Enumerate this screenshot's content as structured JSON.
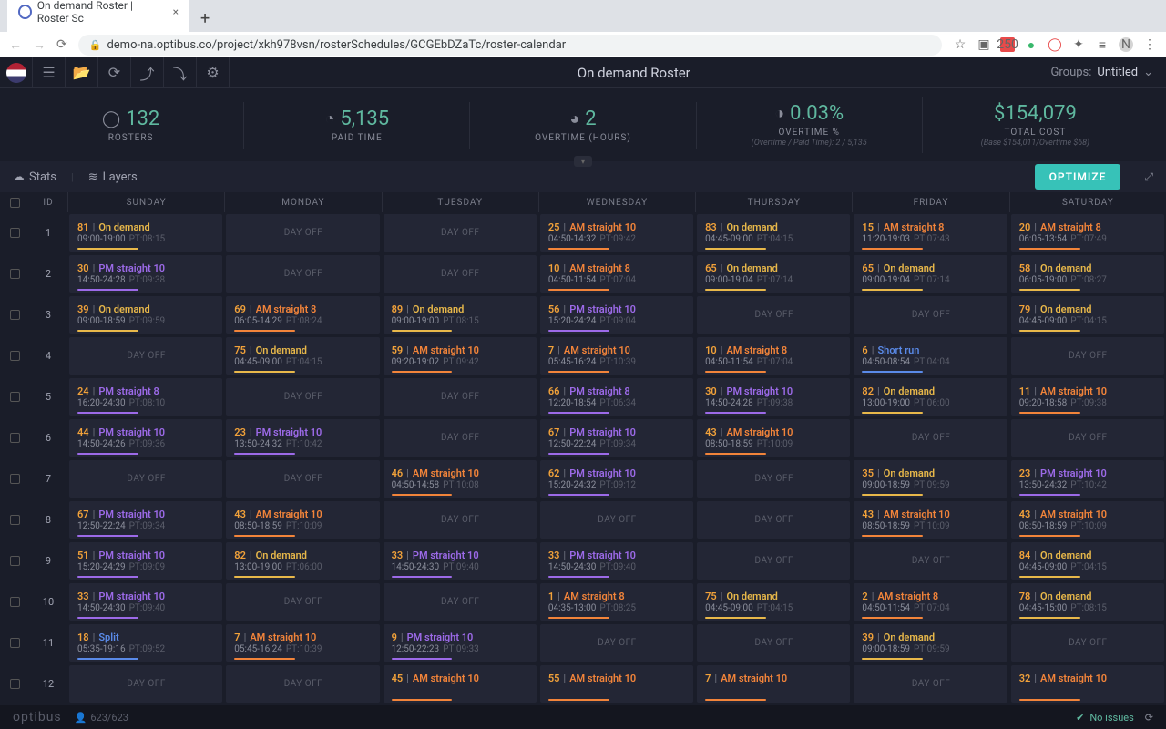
{
  "browser": {
    "tab_title": "On demand Roster | Roster Sc",
    "url": "demo-na.optibus.co/project/xkh978vsn/rosterSchedules/GCGEbDZaTc/roster-calendar",
    "ext_badge": "250",
    "avatar": "N"
  },
  "toolbar": {
    "title": "On demand Roster",
    "groups_label": "Groups:",
    "groups_value": "Untitled"
  },
  "metrics": [
    {
      "value": "132",
      "label": "ROSTERS",
      "sub": ""
    },
    {
      "value": "5,135",
      "label": "PAID TIME",
      "sub": ""
    },
    {
      "value": "2",
      "label": "OVERTIME (HOURS)",
      "sub": ""
    },
    {
      "value": "0.03%",
      "label": "OVERTIME %",
      "sub": "(Overtime / Paid Time): 2 / 5,135"
    },
    {
      "value": "$154,079",
      "label": "TOTAL COST",
      "sub": "(Base $154,011/Overtime $68)"
    }
  ],
  "subbar": {
    "stats": "Stats",
    "layers": "Layers",
    "optimize": "OPTIMIZE"
  },
  "headers": {
    "id": "ID",
    "days": [
      "SUNDAY",
      "MONDAY",
      "TUESDAY",
      "WEDNESDAY",
      "THURSDAY",
      "FRIDAY",
      "SATURDAY"
    ]
  },
  "day_off": "DAY OFF",
  "rows": [
    {
      "id": "1",
      "cells": [
        {
          "t": "on",
          "id": "81",
          "n": "On demand",
          "time": "09:00-19:00",
          "pt": "PT:08:15"
        },
        null,
        null,
        {
          "t": "am",
          "id": "25",
          "n": "AM straight 10",
          "time": "04:50-14:32",
          "pt": "PT:09:42"
        },
        {
          "t": "on",
          "id": "83",
          "n": "On demand",
          "time": "04:45-09:00",
          "pt": "PT:04:15"
        },
        {
          "t": "am",
          "id": "15",
          "n": "AM straight 8",
          "time": "11:20-19:03",
          "pt": "PT:07:43"
        },
        {
          "t": "am",
          "id": "20",
          "n": "AM straight 8",
          "time": "06:05-13:54",
          "pt": "PT:07:49"
        }
      ]
    },
    {
      "id": "2",
      "cells": [
        {
          "t": "pm",
          "id": "30",
          "n": "PM straight 10",
          "time": "14:50-24:28",
          "pt": "PT:09:38"
        },
        null,
        null,
        {
          "t": "am",
          "id": "10",
          "n": "AM straight 8",
          "time": "04:50-11:54",
          "pt": "PT:07:04"
        },
        {
          "t": "on",
          "id": "65",
          "n": "On demand",
          "time": "09:00-19:04",
          "pt": "PT:07:14"
        },
        {
          "t": "on",
          "id": "65",
          "n": "On demand",
          "time": "09:00-19:04",
          "pt": "PT:07:14"
        },
        {
          "t": "on",
          "id": "58",
          "n": "On demand",
          "time": "06:05-19:00",
          "pt": "PT:08:27"
        }
      ]
    },
    {
      "id": "3",
      "cells": [
        {
          "t": "on",
          "id": "39",
          "n": "On demand",
          "time": "09:00-18:59",
          "pt": "PT:09:59"
        },
        {
          "t": "am",
          "id": "69",
          "n": "AM straight 8",
          "time": "06:05-14:29",
          "pt": "PT:08:24"
        },
        {
          "t": "on",
          "id": "89",
          "n": "On demand",
          "time": "09:00-19:00",
          "pt": "PT:08:15"
        },
        {
          "t": "pm",
          "id": "56",
          "n": "PM straight 10",
          "time": "15:20-24:24",
          "pt": "PT:09:04"
        },
        null,
        null,
        {
          "t": "on",
          "id": "79",
          "n": "On demand",
          "time": "04:45-09:00",
          "pt": "PT:04:15"
        }
      ]
    },
    {
      "id": "4",
      "cells": [
        null,
        {
          "t": "on",
          "id": "75",
          "n": "On demand",
          "time": "04:45-09:00",
          "pt": "PT:04:15"
        },
        {
          "t": "am",
          "id": "59",
          "n": "AM straight 10",
          "time": "09:20-19:02",
          "pt": "PT:09:42"
        },
        {
          "t": "am",
          "id": "7",
          "n": "AM straight 10",
          "time": "05:45-16:24",
          "pt": "PT:10:39"
        },
        {
          "t": "am",
          "id": "10",
          "n": "AM straight 8",
          "time": "04:50-11:54",
          "pt": "PT:07:04"
        },
        {
          "t": "sr",
          "id": "6",
          "n": "Short run",
          "time": "04:50-08:54",
          "pt": "PT:04:04"
        },
        null
      ]
    },
    {
      "id": "5",
      "cells": [
        {
          "t": "pm",
          "id": "24",
          "n": "PM straight 8",
          "time": "16:20-24:30",
          "pt": "PT:08:10"
        },
        null,
        null,
        {
          "t": "pm",
          "id": "66",
          "n": "PM straight 8",
          "time": "12:20-18:54",
          "pt": "PT:06:34"
        },
        {
          "t": "pm",
          "id": "30",
          "n": "PM straight 10",
          "time": "14:50-24:28",
          "pt": "PT:09:38"
        },
        {
          "t": "on",
          "id": "82",
          "n": "On demand",
          "time": "13:00-19:00",
          "pt": "PT:06:00"
        },
        {
          "t": "am",
          "id": "11",
          "n": "AM straight 10",
          "time": "09:20-18:58",
          "pt": "PT:09:38"
        }
      ]
    },
    {
      "id": "6",
      "cells": [
        {
          "t": "pm",
          "id": "44",
          "n": "PM straight 10",
          "time": "14:50-24:26",
          "pt": "PT:09:36"
        },
        {
          "t": "pm",
          "id": "23",
          "n": "PM straight 10",
          "time": "13:50-24:32",
          "pt": "PT:10:42"
        },
        null,
        {
          "t": "pm",
          "id": "67",
          "n": "PM straight 10",
          "time": "12:50-22:24",
          "pt": "PT:09:34"
        },
        {
          "t": "am",
          "id": "43",
          "n": "AM straight 10",
          "time": "08:50-18:59",
          "pt": "PT:10:09"
        },
        null,
        null
      ]
    },
    {
      "id": "7",
      "cells": [
        null,
        null,
        {
          "t": "am",
          "id": "46",
          "n": "AM straight 10",
          "time": "04:50-14:58",
          "pt": "PT:10:08"
        },
        {
          "t": "pm",
          "id": "62",
          "n": "PM straight 10",
          "time": "15:20-24:32",
          "pt": "PT:09:12"
        },
        null,
        {
          "t": "on",
          "id": "35",
          "n": "On demand",
          "time": "09:00-18:59",
          "pt": "PT:09:59"
        },
        {
          "t": "pm",
          "id": "23",
          "n": "PM straight 10",
          "time": "13:50-24:32",
          "pt": "PT:10:42"
        }
      ]
    },
    {
      "id": "8",
      "cells": [
        {
          "t": "pm",
          "id": "67",
          "n": "PM straight 10",
          "time": "12:50-22:24",
          "pt": "PT:09:34"
        },
        {
          "t": "am",
          "id": "43",
          "n": "AM straight 10",
          "time": "08:50-18:59",
          "pt": "PT:10:09"
        },
        null,
        null,
        null,
        {
          "t": "am",
          "id": "43",
          "n": "AM straight 10",
          "time": "08:50-18:59",
          "pt": "PT:10:09"
        },
        {
          "t": "am",
          "id": "43",
          "n": "AM straight 10",
          "time": "08:50-18:59",
          "pt": "PT:10:09"
        }
      ]
    },
    {
      "id": "9",
      "cells": [
        {
          "t": "pm",
          "id": "51",
          "n": "PM straight 10",
          "time": "15:20-24:29",
          "pt": "PT:09:09"
        },
        {
          "t": "on",
          "id": "82",
          "n": "On demand",
          "time": "13:00-19:00",
          "pt": "PT:06:00"
        },
        {
          "t": "pm",
          "id": "33",
          "n": "PM straight 10",
          "time": "14:50-24:30",
          "pt": "PT:09:40"
        },
        {
          "t": "pm",
          "id": "33",
          "n": "PM straight 10",
          "time": "14:50-24:30",
          "pt": "PT:09:40"
        },
        null,
        null,
        {
          "t": "on",
          "id": "84",
          "n": "On demand",
          "time": "04:45-09:00",
          "pt": "PT:04:15"
        }
      ]
    },
    {
      "id": "10",
      "cells": [
        {
          "t": "pm",
          "id": "33",
          "n": "PM straight 10",
          "time": "14:50-24:30",
          "pt": "PT:09:40"
        },
        null,
        null,
        {
          "t": "am",
          "id": "1",
          "n": "AM straight 8",
          "time": "04:35-13:00",
          "pt": "PT:08:25"
        },
        {
          "t": "on",
          "id": "75",
          "n": "On demand",
          "time": "04:45-09:00",
          "pt": "PT:04:15"
        },
        {
          "t": "am",
          "id": "2",
          "n": "AM straight 8",
          "time": "04:50-11:54",
          "pt": "PT:07:04"
        },
        {
          "t": "on",
          "id": "78",
          "n": "On demand",
          "time": "04:45-15:00",
          "pt": "PT:08:15"
        }
      ]
    },
    {
      "id": "11",
      "cells": [
        {
          "t": "sp",
          "id": "18",
          "n": "Split",
          "time": "05:35-19:16",
          "pt": "PT:09:52"
        },
        {
          "t": "am",
          "id": "7",
          "n": "AM straight 10",
          "time": "05:45-16:24",
          "pt": "PT:10:39"
        },
        {
          "t": "pm",
          "id": "9",
          "n": "PM straight 10",
          "time": "12:50-22:23",
          "pt": "PT:09:33"
        },
        null,
        null,
        {
          "t": "on",
          "id": "39",
          "n": "On demand",
          "time": "09:00-18:59",
          "pt": "PT:09:59"
        },
        null
      ]
    },
    {
      "id": "12",
      "cells": [
        null,
        null,
        {
          "t": "am",
          "id": "45",
          "n": "AM straight 10",
          "time": "",
          "pt": ""
        },
        {
          "t": "am",
          "id": "55",
          "n": "AM straight 10",
          "time": "",
          "pt": ""
        },
        {
          "t": "am",
          "id": "7",
          "n": "AM straight 10",
          "time": "",
          "pt": ""
        },
        null,
        {
          "t": "am",
          "id": "32",
          "n": "AM straight 10",
          "time": "",
          "pt": ""
        }
      ]
    }
  ],
  "footer": {
    "brand": "optibus",
    "count": "623/623",
    "issues": "No issues"
  }
}
